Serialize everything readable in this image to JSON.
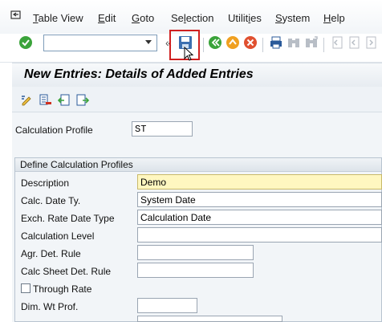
{
  "menu": {
    "items": [
      {
        "pre": "",
        "u": "T",
        "post": "able View"
      },
      {
        "pre": "",
        "u": "E",
        "post": "dit"
      },
      {
        "pre": "",
        "u": "G",
        "post": "oto"
      },
      {
        "pre": "Se",
        "u": "l",
        "post": "ection"
      },
      {
        "pre": "Utilit",
        "u": "i",
        "post": "es"
      },
      {
        "pre": "",
        "u": "S",
        "post": "ystem"
      },
      {
        "pre": "",
        "u": "H",
        "post": "elp"
      }
    ]
  },
  "toolbar": {
    "command_field_value": "",
    "collapse_glyph": "«"
  },
  "title": "New Entries: Details of Added Entries",
  "header_field": {
    "label": "Calculation Profile",
    "value": "ST"
  },
  "group": {
    "title": "Define Calculation Profiles",
    "rows": [
      {
        "label": "Description",
        "value": "Demo"
      },
      {
        "label": "Calc. Date Ty.",
        "value": "System Date"
      },
      {
        "label": "Exch. Rate Date Type",
        "value": "Calculation Date"
      },
      {
        "label": "Calculation Level",
        "value": ""
      },
      {
        "label": "Agr. Det. Rule",
        "value": ""
      },
      {
        "label": "Calc Sheet Det. Rule",
        "value": ""
      },
      {
        "label": "Through Rate",
        "value": ""
      },
      {
        "label": "Dim. Wt Prof.",
        "value": ""
      }
    ]
  },
  "colors": {
    "accent_yellow": "#fff7c0",
    "highlight_red": "#d02020",
    "green": "#3aa33a",
    "orange": "#f0a020"
  }
}
